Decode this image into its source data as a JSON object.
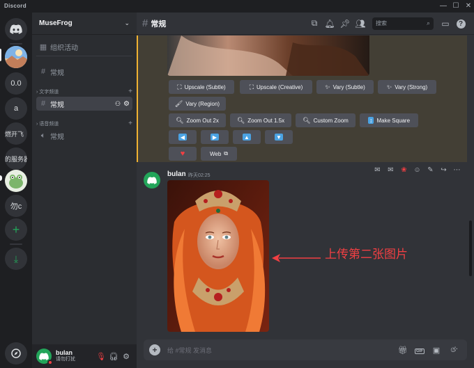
{
  "app": {
    "name": "Discord"
  },
  "rail": {
    "items": [
      {
        "label": "0.0"
      },
      {
        "label": "a"
      },
      {
        "label": "燃开飞"
      },
      {
        "label": "的服务器"
      },
      {
        "label": "勿c"
      }
    ]
  },
  "server": {
    "name": "MuseFrog"
  },
  "sidebar": {
    "events_label": "组织活动",
    "top_channel": "常规",
    "text_category": "文字频道",
    "text_channel": "常规",
    "voice_category": "语音频道",
    "voice_channel": "常规"
  },
  "user": {
    "name": "bulan",
    "status": "请勿打扰"
  },
  "channel": {
    "name": "常规"
  },
  "search": {
    "placeholder": "搜索"
  },
  "buttons": {
    "upscale_subtle": "Upscale (Subtle)",
    "upscale_creative": "Upscale (Creative)",
    "vary_subtle": "Vary (Subtle)",
    "vary_strong": "Vary (Strong)",
    "vary_region": "Vary (Region)",
    "zoom_out_2x": "Zoom Out 2x",
    "zoom_out_15x": "Zoom Out 1.5x",
    "custom_zoom": "Custom Zoom",
    "make_square": "Make Square",
    "web": "Web"
  },
  "message": {
    "author": "bulan",
    "timestamp": "昨天02:25"
  },
  "annotation": {
    "text": "上传第二张图片",
    "color": "#f23f43"
  },
  "composer": {
    "placeholder": "给 #常规 发消息"
  },
  "colors": {
    "accent": "#5865f2",
    "online": "#23a55a",
    "highlight": "#f0b232",
    "arrow_blue": "#4ba3e3"
  }
}
